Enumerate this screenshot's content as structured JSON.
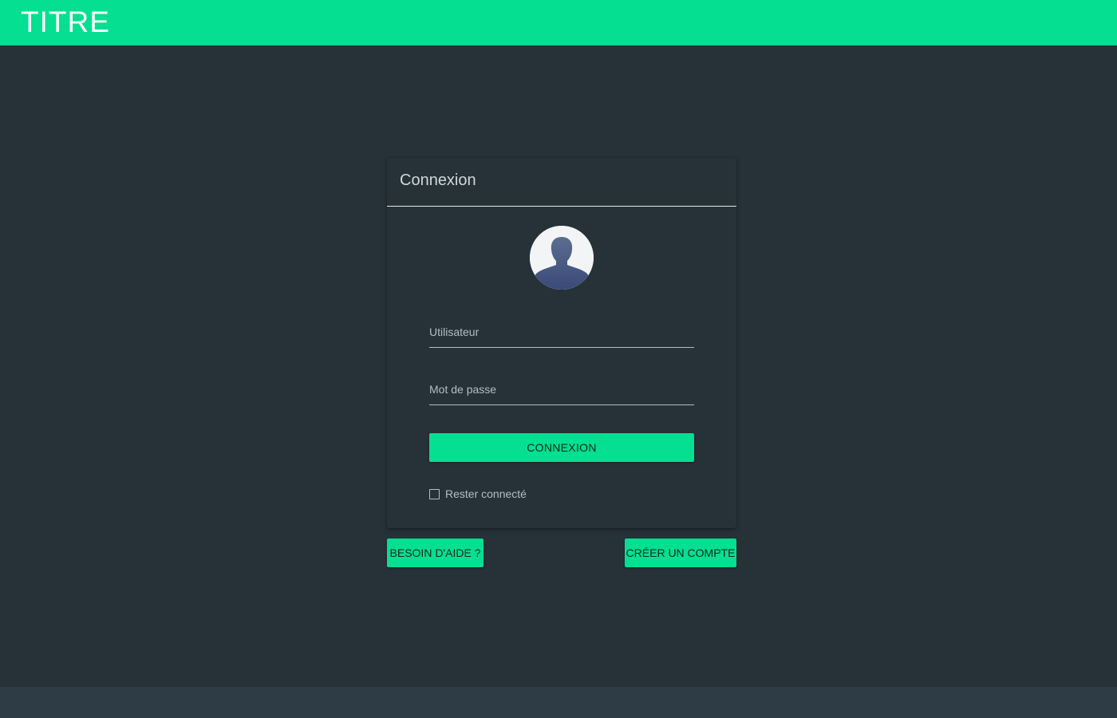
{
  "header": {
    "title": "TITRE"
  },
  "login_card": {
    "title": "Connexion",
    "avatar_icon": "user-avatar-icon",
    "username_label": "Utilisateur",
    "password_label": "Mot de passe",
    "submit_label": "CONNEXION",
    "remember_label": "Rester connecté",
    "remember_checked": false
  },
  "actions": {
    "help_label": "BESOIN D'AIDE ?",
    "create_account_label": "CRÉER UN COMPTE"
  },
  "colors": {
    "accent": "#04df91",
    "background": "#263238",
    "footer": "#2e3d45"
  }
}
